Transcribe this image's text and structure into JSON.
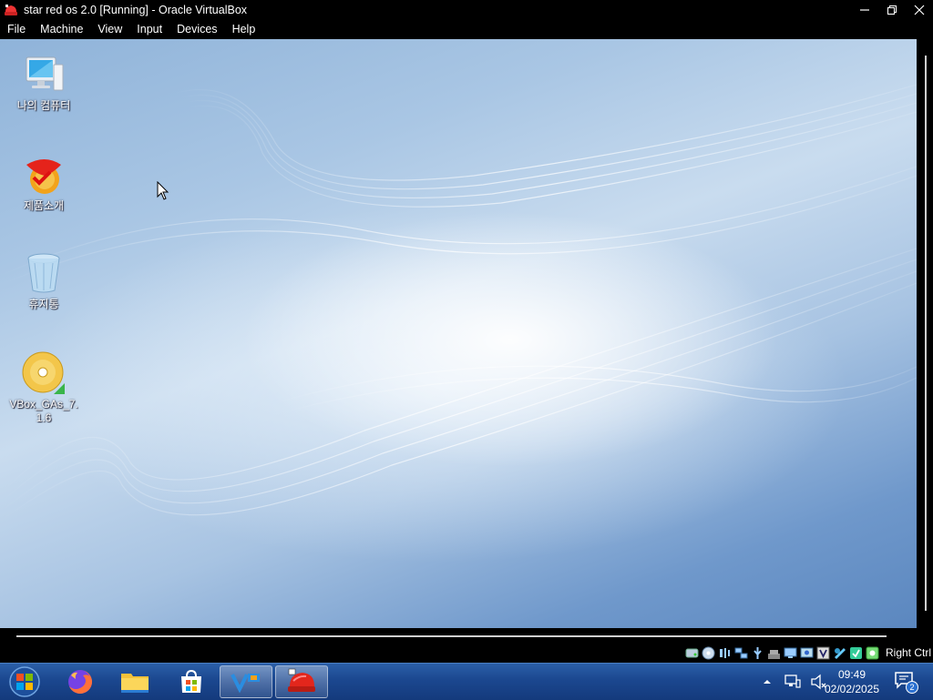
{
  "window": {
    "title": "star red os 2.0 [Running] - Oracle VirtualBox",
    "controls": [
      "minimize",
      "restore",
      "close"
    ]
  },
  "menubar": {
    "items": [
      "File",
      "Machine",
      "View",
      "Input",
      "Devices",
      "Help"
    ]
  },
  "desktop": {
    "icons": [
      {
        "label": "나의 컴퓨터",
        "icon": "computer-icon"
      },
      {
        "label": "제품소개",
        "icon": "product-icon"
      },
      {
        "label": "휴지통",
        "icon": "recycle-bin-icon"
      },
      {
        "label": "VBox_GAs_7.1.6",
        "icon": "cd-icon"
      }
    ]
  },
  "vbox_status": {
    "host_key": "Right Ctrl",
    "icons": [
      "hard-disk-icon",
      "optical-drive-icon",
      "audio-icon",
      "network-icon",
      "usb-icon",
      "shared-folders-icon",
      "display-icon",
      "recording-icon",
      "video-capture-icon",
      "cpu-icon",
      "mouse-integration-icon",
      "guest-additions-icon"
    ]
  },
  "taskbar": {
    "pinned": [
      "start-orb-icon",
      "firefox-icon",
      "file-explorer-icon",
      "store-icon",
      "virtualbox-icon",
      "star-red-os-icon"
    ],
    "tray": {
      "time": "09:49",
      "date": "02/02/2025",
      "notification_count": "2"
    }
  },
  "colors": {
    "taskbar": "#1b478f",
    "desktop_base": "#a9c6e4"
  }
}
